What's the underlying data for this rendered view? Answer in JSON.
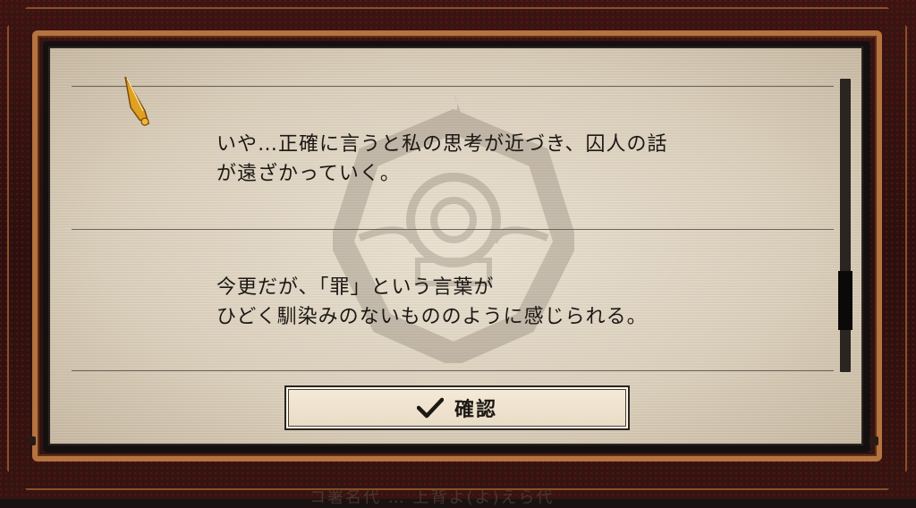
{
  "dialog": {
    "entries": [
      {
        "text": "いや…正確に言うと私の思考が近づき、囚人の話\nが遠ざかっていく。"
      },
      {
        "text": "今更だが、「罪」という言葉が\nひどく馴染みのないもののように感じられる。"
      }
    ],
    "confirm_label": "確認",
    "scroll_position": 0.82
  },
  "background_text": "コ署名代 … 上背よ(よ)えら代",
  "colors": {
    "frame_accent": "#b5733f",
    "paper": "#e4d9c6",
    "text": "#1c1814"
  }
}
